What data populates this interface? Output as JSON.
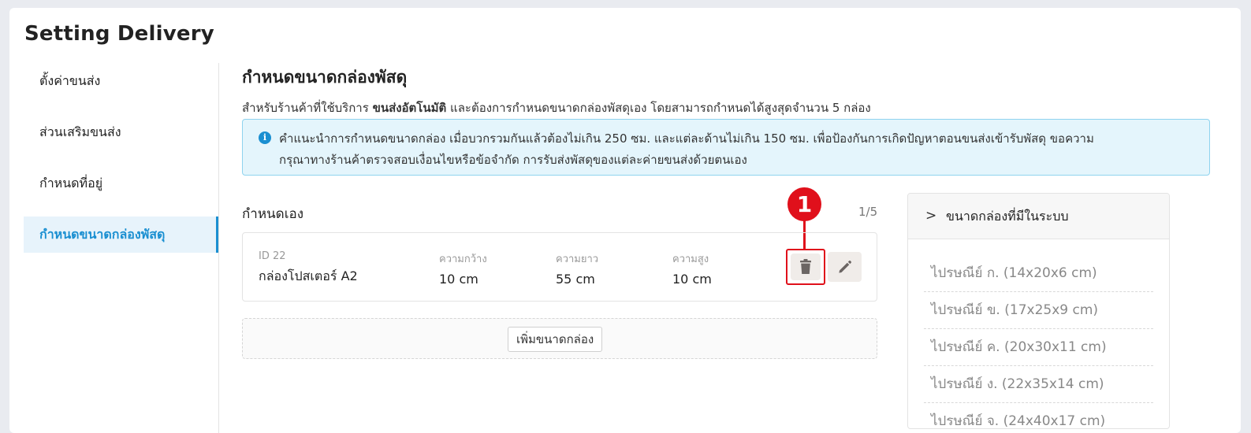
{
  "page": {
    "title": "Setting Delivery"
  },
  "sidebar": {
    "items": [
      {
        "label": "ตั้งค่าขนส่ง"
      },
      {
        "label": "ส่วนเสริมขนส่ง"
      },
      {
        "label": "กำหนดที่อยู่"
      },
      {
        "label": "กำหนดขนาดกล่องพัสดุ"
      }
    ],
    "active_index": 3
  },
  "main": {
    "title": "กำหนดขนาดกล่องพัสดุ",
    "desc_prefix": "สำหรับร้านค้าที่ใช้บริการ",
    "desc_bold": "ขนส่งอัตโนมัติ",
    "desc_suffix": "และต้องการกำหนดขนาดกล่องพัสดุเอง โดยสามารถกำหนดได้สูงสุดจำนวน 5 กล่อง",
    "info_icon": "i",
    "info_line1": "คำแนะนำการกำหนดขนาดกล่อง เมื่อบวกรวมกันแล้วต้องไม่เกิน 250 ซม. และแต่ละด้านไม่เกิน 150 ซม. เพื่อป้องกันการเกิดปัญหาตอนขนส่งเข้ารับพัสดุ ขอความ",
    "info_line2": "กรุณาทางร้านค้าตรวจสอบเงื่อนไขหรือข้อจำกัด การรับส่งพัสดุของแต่ละค่ายขนส่งด้วยตนเอง",
    "custom_label": "กำหนดเอง",
    "counter": "1/5",
    "boxes": [
      {
        "id": "ID 22",
        "name": "กล่องโปสเตอร์ A2",
        "width_label": "ความกว้าง",
        "width": "10 cm",
        "length_label": "ความยาว",
        "length": "55 cm",
        "height_label": "ความสูง",
        "height": "10 cm"
      }
    ],
    "add_button": "เพิ่มขนาดกล่อง",
    "callout_number": "1",
    "icons": {
      "delete": "trash-icon",
      "edit": "pencil-icon",
      "info": "info-icon",
      "expand": "chevron-right-icon"
    },
    "colors": {
      "accent": "#1a8fd1",
      "highlight": "#e0101b"
    }
  },
  "presets": {
    "header": "ขนาดกล่องที่มีในระบบ",
    "chevron": ">",
    "items": [
      "ไปรษณีย์ ก. (14x20x6 cm)",
      "ไปรษณีย์ ข. (17x25x9 cm)",
      "ไปรษณีย์ ค. (20x30x11 cm)",
      "ไปรษณีย์ ง. (22x35x14 cm)",
      "ไปรษณีย์ จ. (24x40x17 cm)"
    ]
  }
}
